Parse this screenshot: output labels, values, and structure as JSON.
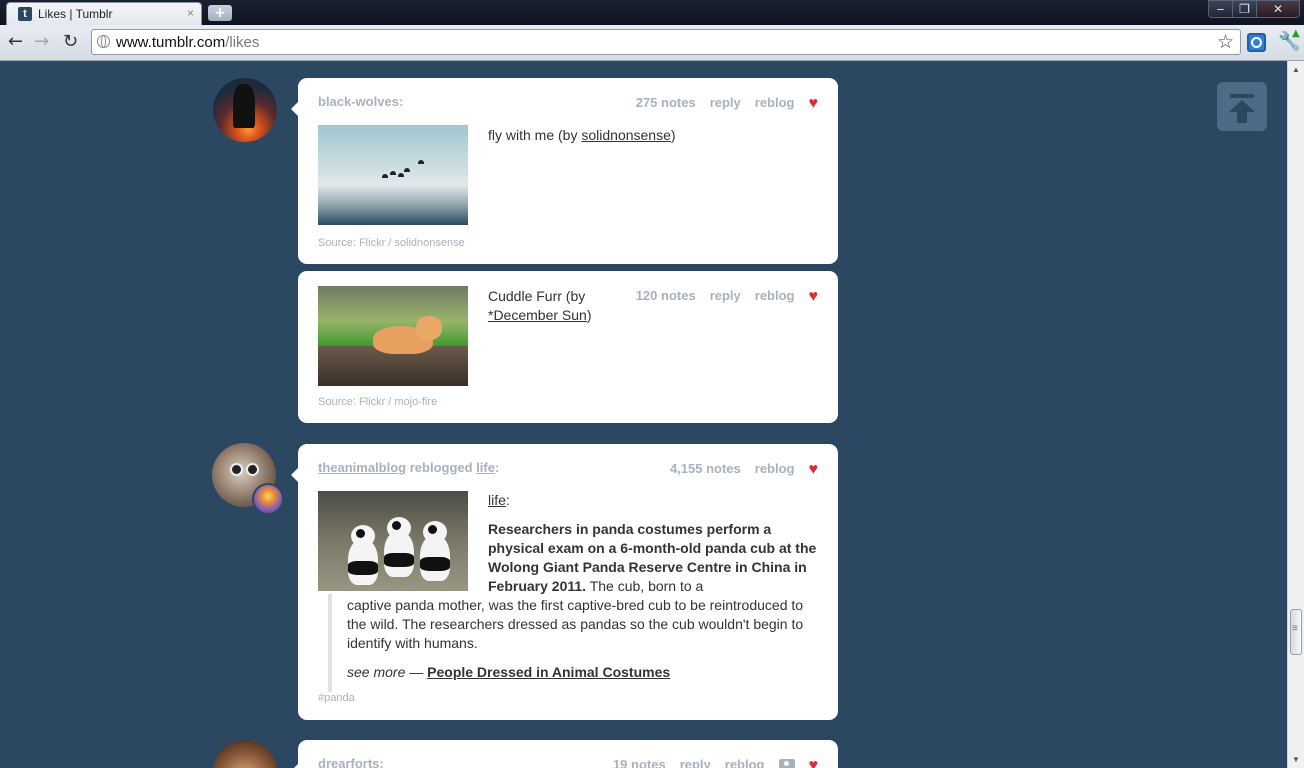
{
  "browser": {
    "tab_title": "Likes | Tumblr",
    "tab_close": "×",
    "favicon_letter": "t",
    "new_tab": "+",
    "url_host": "www.tumblr.com",
    "url_path": "/likes",
    "window_min": "‒",
    "window_max": "❐",
    "window_close": "✕"
  },
  "posts": [
    {
      "author": "black-wolves",
      "author_suffix": ":",
      "notes": "275 notes",
      "reply": "reply",
      "reblog": "reblog",
      "caption_text": "fly with me (by ",
      "caption_link": "solidnonsense",
      "caption_end": ")",
      "source": "Source: Flickr / solidnonsense"
    },
    {
      "notes": "120 notes",
      "reply": "reply",
      "reblog": "reblog",
      "caption_text": "Cuddle Furr (by",
      "caption_link": "*December Sun",
      "caption_end": ")",
      "source": "Source: Flickr / mojo-fire"
    },
    {
      "author": "theanimalblog",
      "reblogged_text": " reblogged ",
      "reblogged_from": "life",
      "author_suffix": ":",
      "notes": "4,155 notes",
      "reblog": "reblog",
      "life_link": "life",
      "life_suffix": ":",
      "lead_bold": "Researchers in panda costumes perform a physical exam on a 6-month-old panda cub at the Wolong Giant Panda Reserve Centre in China in February 2011.",
      "lead_rest_1": " The cub, born to a",
      "quote_body": "captive panda mother, was the first captive-bred cub to be reintroduced to the wild. The researchers dressed as pandas so the cub wouldn't begin to identify with humans.",
      "see_more": "see more",
      "see_more_dash": " — ",
      "see_more_link": "People Dressed in Animal Costumes",
      "tag": "#panda"
    },
    {
      "author": "drearforts",
      "author_suffix": ":",
      "notes": "19 notes",
      "reply": "reply",
      "reblog": "reblog"
    }
  ],
  "icons": {
    "heart": "♥",
    "back": "←",
    "forward": "→",
    "reload": "↻",
    "star": "☆",
    "wrench": "🔧",
    "wrench_badge": "▲",
    "scroll_up": "▲",
    "scroll_down": "▼"
  },
  "colors": {
    "page_bg": "#2c4762",
    "heart": "#d93030",
    "meta_gray": "#a8b2bc"
  }
}
